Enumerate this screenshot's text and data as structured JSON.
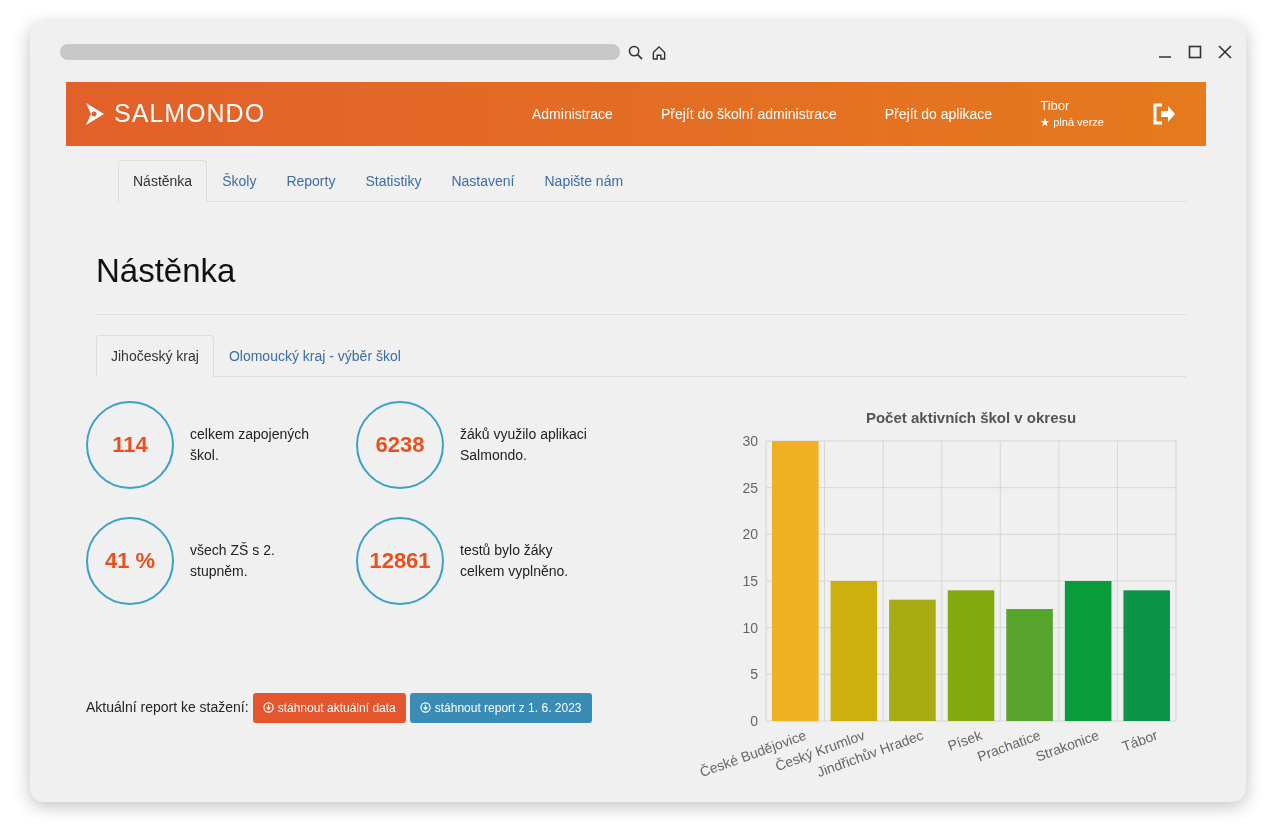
{
  "navbar": {
    "brand": "SALMONDO",
    "links": [
      {
        "label": "Administrace"
      },
      {
        "label": "Přejít do školní administrace"
      },
      {
        "label": "Přejít do aplikace"
      }
    ],
    "user": {
      "name": "Tibor",
      "plan_mark": "★",
      "plan": "plná verze"
    }
  },
  "tabs": [
    {
      "label": "Nástěnka",
      "selected": true
    },
    {
      "label": "Školy",
      "selected": false
    },
    {
      "label": "Reporty",
      "selected": false
    },
    {
      "label": "Statistiky",
      "selected": false
    },
    {
      "label": "Nastavení",
      "selected": false
    },
    {
      "label": "Napište nám",
      "selected": false
    }
  ],
  "page_title": "Nástěnka",
  "region_tabs": [
    {
      "label": "Jihočeský kraj",
      "selected": true
    },
    {
      "label": "Olomoucký kraj - výběr škol",
      "selected": false
    }
  ],
  "stats": [
    {
      "value": "114",
      "text": "celkem zapojených škol."
    },
    {
      "value": "6238",
      "text": "žáků využilo aplikaci Salmondo."
    },
    {
      "value": "41 %",
      "text": "všech ZŠ s 2. stupněm."
    },
    {
      "value": "12861",
      "text": "testů bylo žáky celkem vyplněno."
    }
  ],
  "download": {
    "label": "Aktuální report ke stažení:",
    "buttons": [
      {
        "label": "stáhnout aktuální data",
        "kind": "danger"
      },
      {
        "label": "stáhnout report z 1. 6. 2023",
        "kind": "info"
      }
    ]
  },
  "chart": {
    "chart_data": {
      "type": "bar",
      "title": "Počet aktivních škol v okresu",
      "categories": [
        "České Budějovice",
        "Český Krumlov",
        "Jindřichův Hradec",
        "Písek",
        "Prachatice",
        "Strakonice",
        "Tábor"
      ],
      "grid": true,
      "series": [
        {
          "colors": [
            "#efb021",
            "#cdb00b",
            "#a8ac12",
            "#84ab0e",
            "#58a52e",
            "#0a9c3a",
            "#0c9449"
          ],
          "values": [
            30,
            15,
            13,
            14,
            12,
            15,
            14
          ]
        }
      ],
      "ylim": [
        0,
        30
      ],
      "yticks": [
        0,
        5,
        10,
        15,
        20,
        25,
        30
      ]
    }
  }
}
